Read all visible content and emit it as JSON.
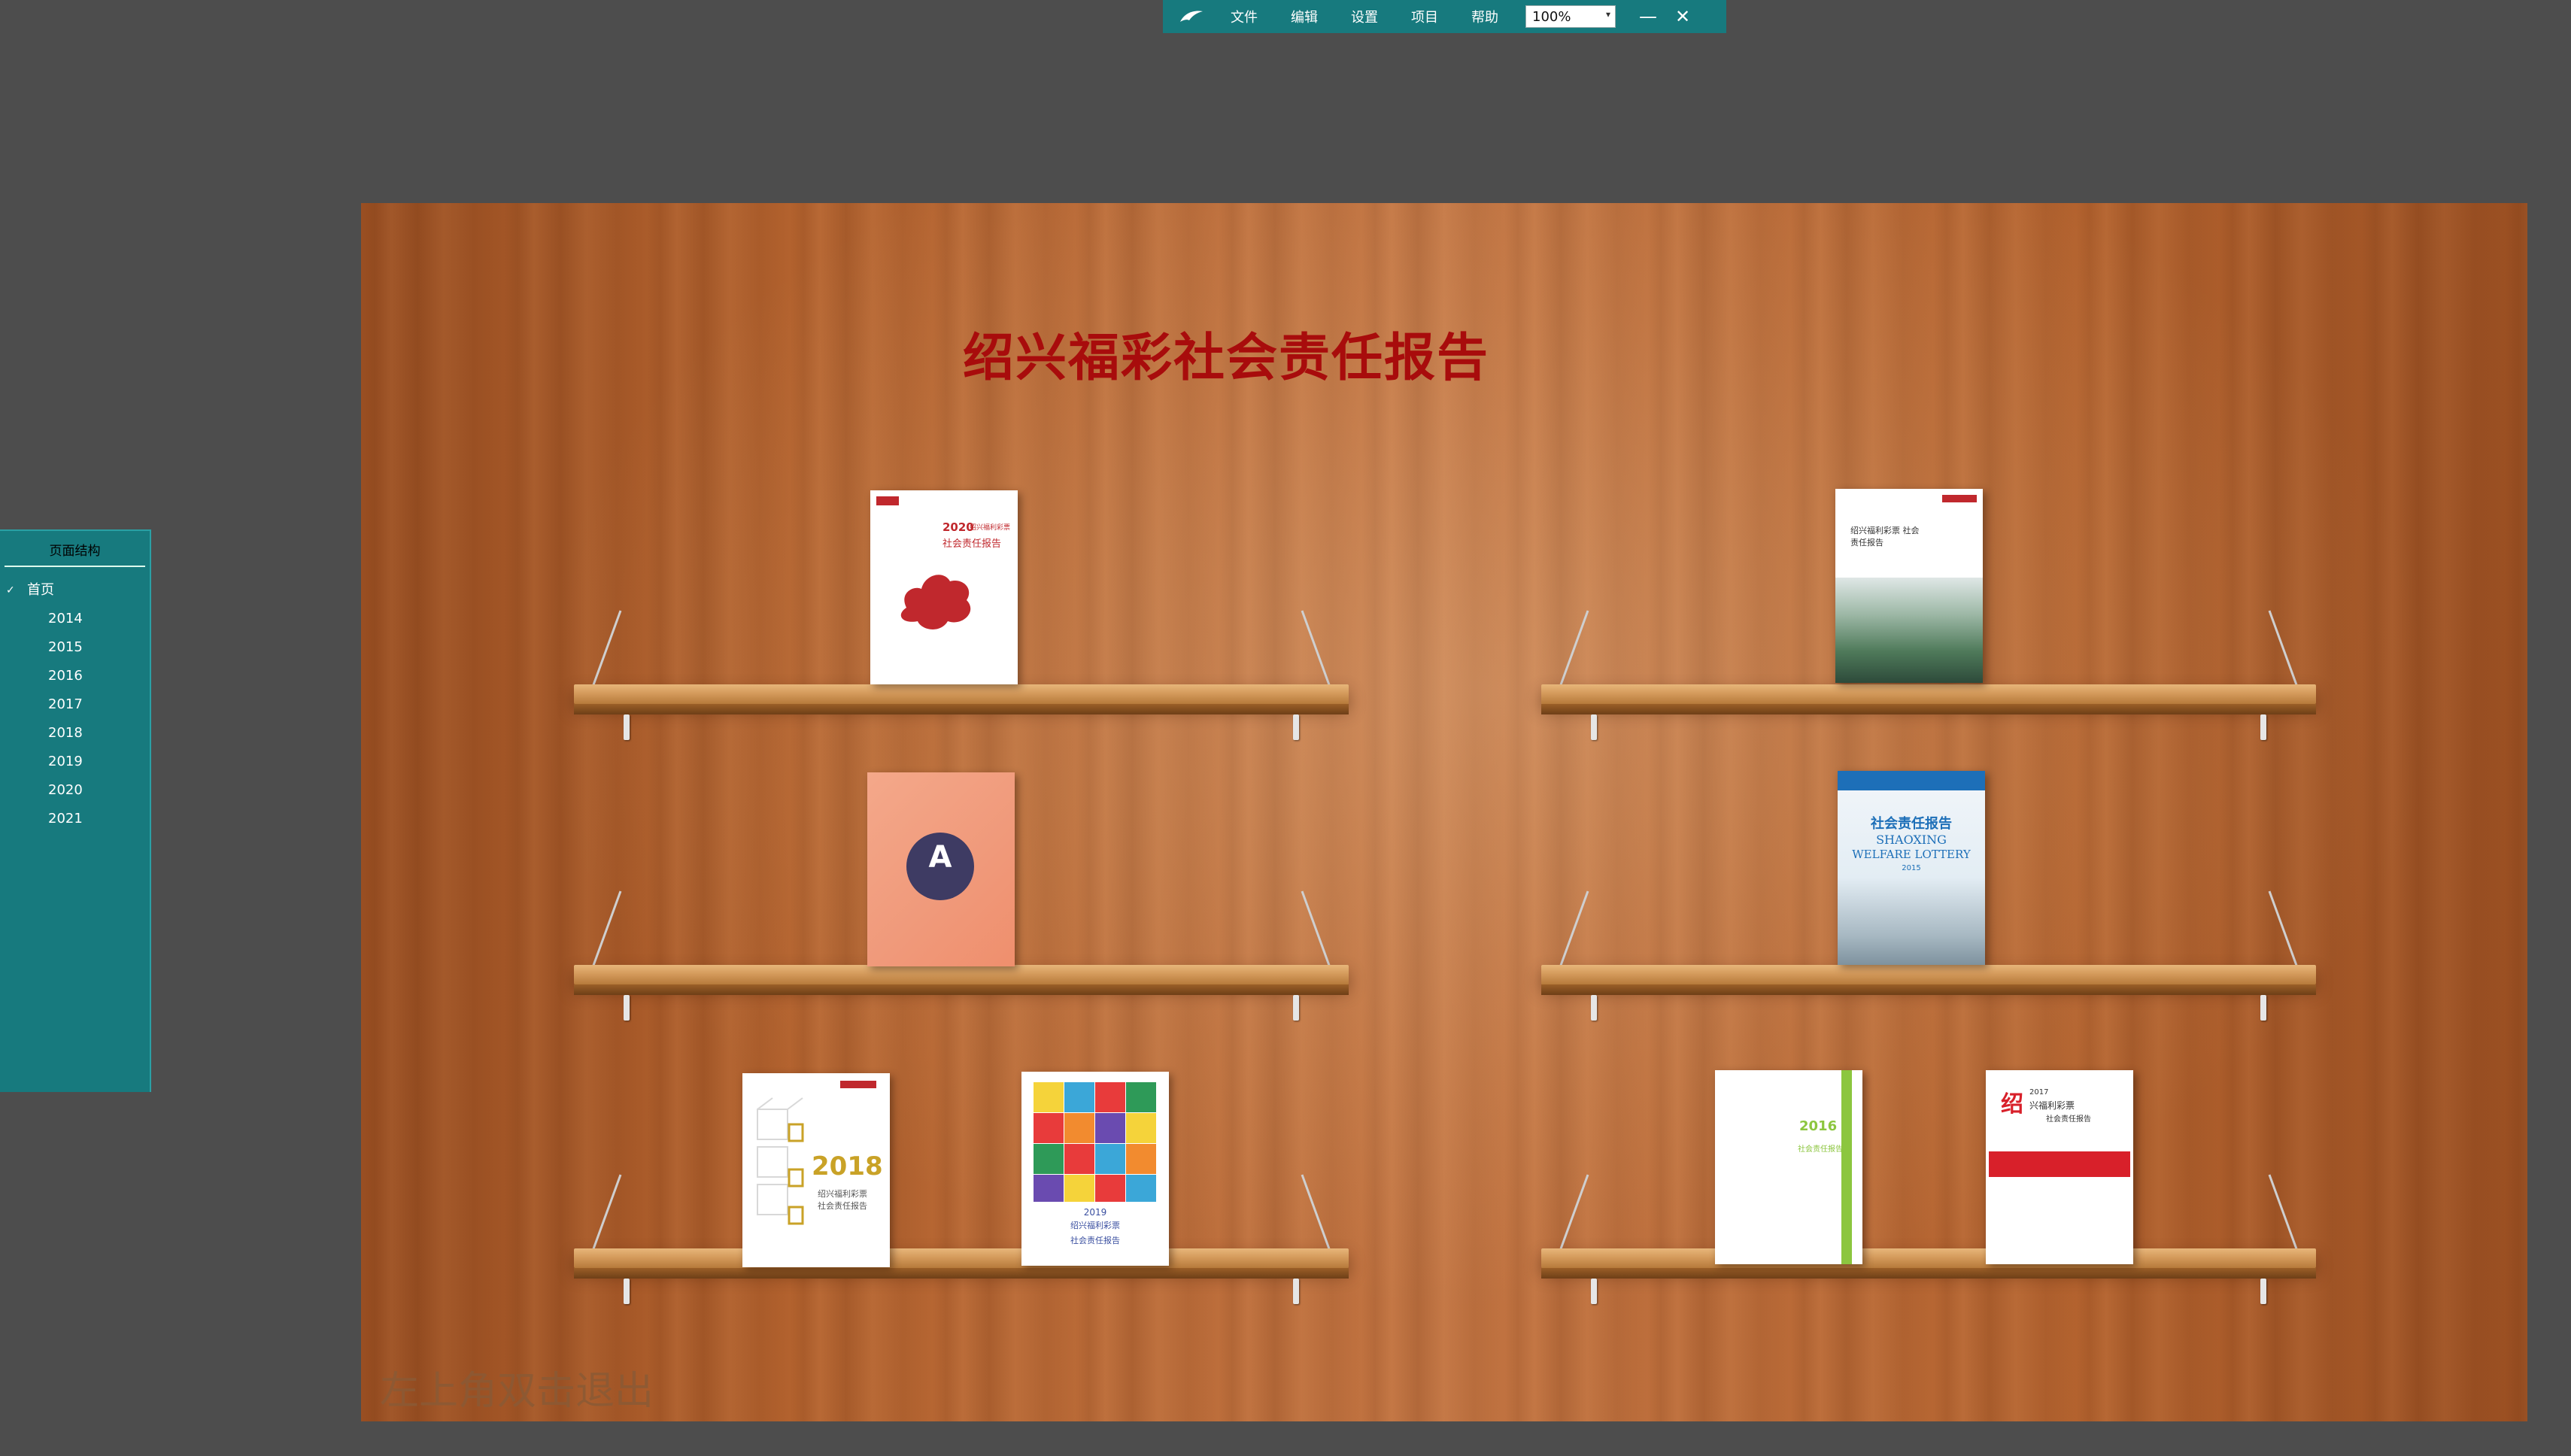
{
  "toolbar": {
    "menus": [
      "文件",
      "编辑",
      "设置",
      "项目",
      "帮助"
    ],
    "zoom": "100%",
    "minimize": "—",
    "close": "✕",
    "icons": {
      "logo": "dolphin-logo-icon"
    }
  },
  "sidebar": {
    "title": "页面结构",
    "root": {
      "label": "首页",
      "check": "✓"
    },
    "items": [
      "2014",
      "2015",
      "2016",
      "2017",
      "2018",
      "2019",
      "2020",
      "2021"
    ]
  },
  "wall": {
    "title": "绍兴福彩社会责任报告",
    "exit_hint": "左上角双击退出"
  },
  "books": {
    "b2020": {
      "year_line": "2020",
      "subtitle": "绍兴福利彩票",
      "title": "社会责任报告"
    },
    "b2014": {
      "title": "绍兴福利彩票 社会责任报告"
    },
    "bA": {
      "letter": "A"
    },
    "b2015": {
      "title": "社会责任报告",
      "en1": "SHAOXING",
      "en2": "WELFARE LOTTERY",
      "year": "2015"
    },
    "b2018": {
      "year": "2018",
      "line1": "绍兴福利彩票",
      "line2": "社会责任报告"
    },
    "b2019": {
      "year": "2019",
      "line1": "绍兴福利彩票",
      "line2": "社会责任报告"
    },
    "b2016": {
      "year": "2016",
      "title": "社会责任报告"
    },
    "b2017": {
      "year": "2017",
      "line1": "兴福利彩票",
      "line2": "社会责任报告",
      "big": "绍"
    }
  },
  "colors": {
    "toolbar_bg": "#177a7e",
    "title_red": "#a80c0c",
    "wood": "#b3622e"
  }
}
